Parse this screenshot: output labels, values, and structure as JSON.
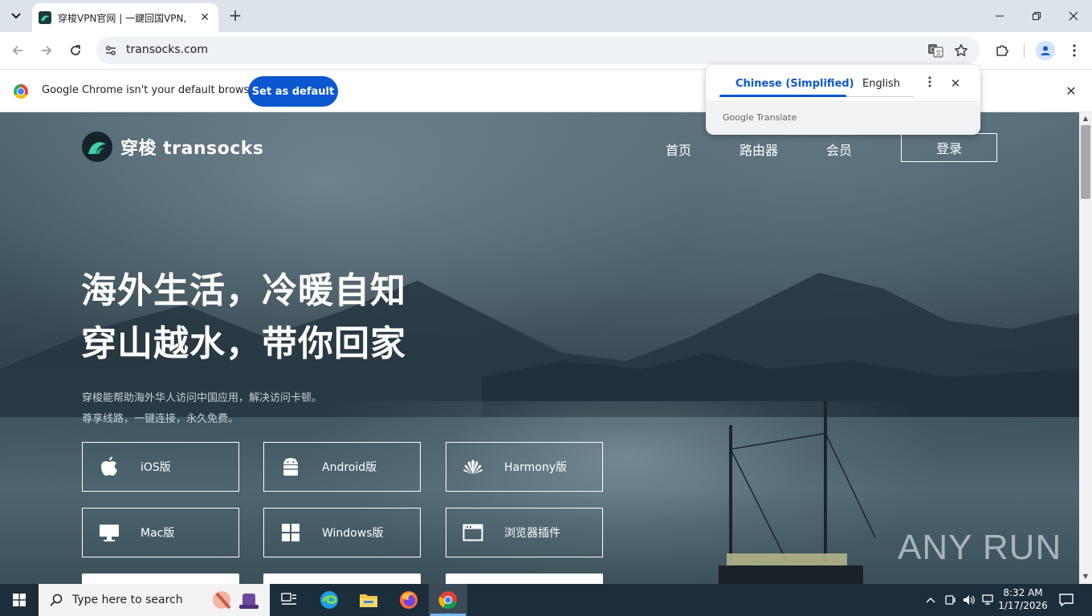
{
  "browser": {
    "tab_title": "穿梭VPN官网 | 一鍵回国VPN,",
    "url": "transocks.com",
    "infobar_text": "Google Chrome isn't your default browser",
    "set_default_label": "Set as default"
  },
  "translate_popup": {
    "source_language": "Chinese (Simplified)",
    "target_language": "English",
    "brand": "Google Translate"
  },
  "site": {
    "logo_text": "穿梭 transocks",
    "nav": [
      "首页",
      "路由器",
      "会员"
    ],
    "login_label": "登录",
    "headline_1": "海外生活，冷暖自知",
    "headline_2": "穿山越水，带你回家",
    "subline_1": "穿梭能帮助海外华人访问中国应用，解决访问卡顿。",
    "subline_2": "尊享线路，一键连接，永久免费。",
    "downloads": [
      {
        "label": "iOS版",
        "icon": "apple-icon"
      },
      {
        "label": "Android版",
        "icon": "android-icon"
      },
      {
        "label": "Harmony版",
        "icon": "huawei-icon"
      },
      {
        "label": "Mac版",
        "icon": "monitor-icon"
      },
      {
        "label": "Windows版",
        "icon": "windows-icon"
      },
      {
        "label": "浏览器插件",
        "icon": "browser-window-icon"
      }
    ],
    "watermark": "ANY RUN"
  },
  "taskbar": {
    "search_placeholder": "Type here to search",
    "time": "8:32 AM",
    "date": "1/17/2026"
  },
  "colors": {
    "accent": "#0b57d0",
    "taskbar": "#1c2d3b",
    "tab_strip": "#dde3ea"
  }
}
